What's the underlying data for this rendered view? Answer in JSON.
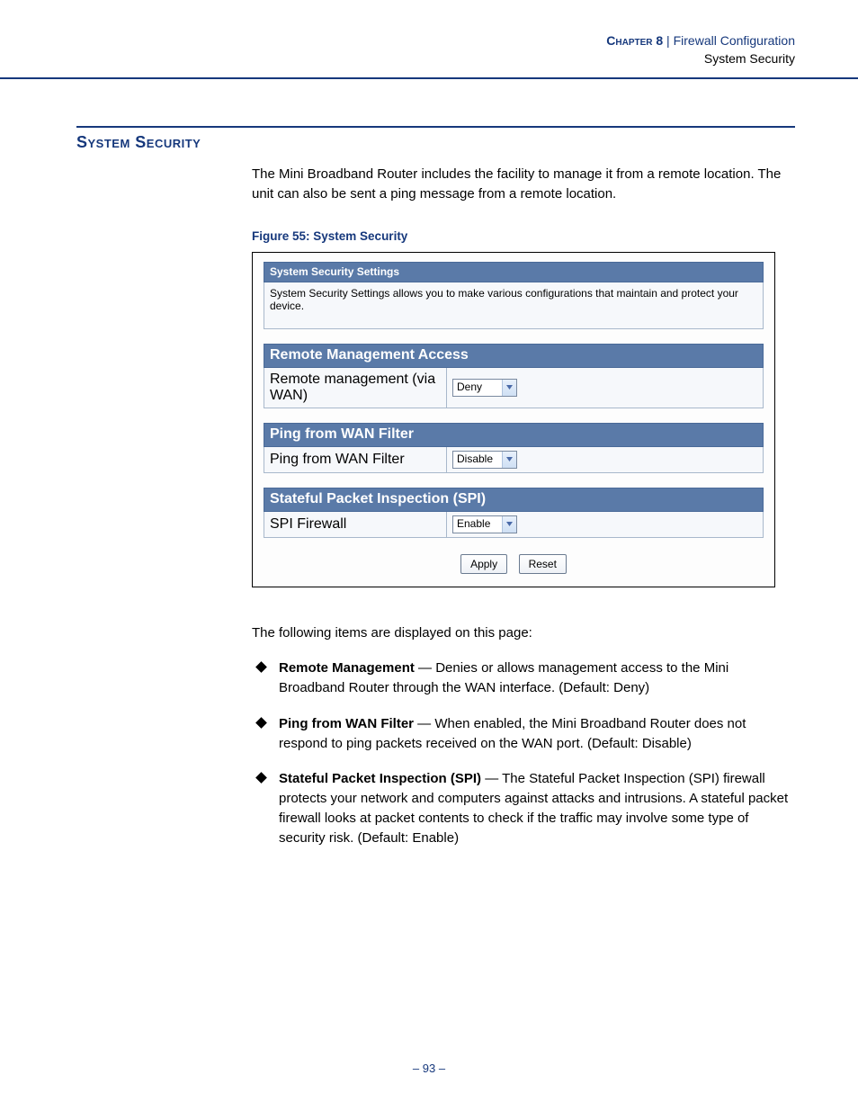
{
  "header": {
    "chapter_label": "Chapter 8",
    "separator": "  |  ",
    "chapter_title": "Firewall Configuration",
    "section": "System Security"
  },
  "section": {
    "heading": "System Security",
    "intro": "The Mini Broadband Router includes the facility to manage it from a remote location. The unit can also be sent a ping message from a remote location."
  },
  "figure": {
    "caption": "Figure 55:  System Security",
    "panel_title": "System Security Settings",
    "panel_desc": "System Security Settings allows you to make various configurations that maintain and protect your device.",
    "groups": [
      {
        "title": "Remote Management Access",
        "row_label": "Remote management (via WAN)",
        "select_value": "Deny"
      },
      {
        "title": "Ping from WAN Filter",
        "row_label": "Ping from WAN Filter",
        "select_value": "Disable"
      },
      {
        "title": "Stateful Packet Inspection (SPI)",
        "row_label": "SPI Firewall",
        "select_value": "Enable"
      }
    ],
    "buttons": {
      "apply": "Apply",
      "reset": "Reset"
    }
  },
  "items_intro": "The following items are displayed on this page:",
  "items": [
    {
      "label": "Remote Management",
      "text": " — Denies or allows management access to the Mini Broadband Router through the WAN interface. (Default: Deny)"
    },
    {
      "label": "Ping from WAN Filter",
      "text": " — When enabled, the Mini Broadband Router does not respond to ping packets received on the WAN port. (Default: Disable)"
    },
    {
      "label": "Stateful Packet Inspection (SPI)",
      "text": " — The Stateful Packet Inspection (SPI) firewall protects your network and computers against attacks and intrusions. A stateful packet firewall looks at packet contents to check if the traffic may involve some type of security risk. (Default: Enable)"
    }
  ],
  "page_number": "– 93 –"
}
